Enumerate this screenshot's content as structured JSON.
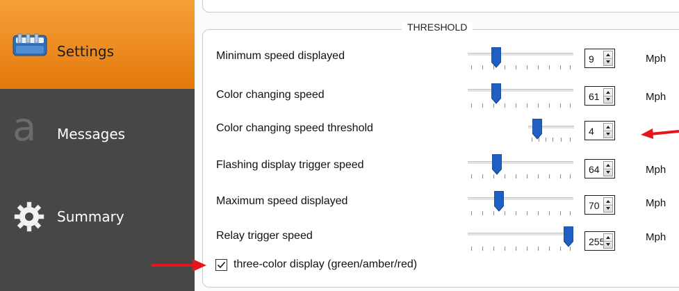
{
  "sidebar": {
    "items": [
      {
        "label": "Settings",
        "icon": "settings-dashboard-icon",
        "active": true
      },
      {
        "label": "Messages",
        "icon": "messages-letter-a-icon",
        "active": false
      },
      {
        "label": "Summary",
        "icon": "gear-icon",
        "active": false
      }
    ]
  },
  "threshold": {
    "title": "THRESHOLD",
    "rows": [
      {
        "label": "Minimum speed displayed",
        "value": "9",
        "unit": "Mph"
      },
      {
        "label": "Color changing speed",
        "value": "61",
        "unit": "Mph"
      },
      {
        "label": "Color changing speed threshold",
        "value": "4",
        "unit": ""
      },
      {
        "label": "Flashing display trigger speed",
        "value": "64",
        "unit": "Mph"
      },
      {
        "label": "Maximum speed displayed",
        "value": "70",
        "unit": "Mph"
      },
      {
        "label": "Relay trigger speed",
        "value": "255",
        "unit": "Mph"
      }
    ],
    "checkbox": {
      "label": "three-color display (green/amber/red)",
      "checked": true
    }
  },
  "colors": {
    "active_nav": "#f08d22",
    "sidebar_bg": "#474747",
    "annotation_arrow": "#e8141b",
    "slider_thumb": "#1f5fc4"
  }
}
